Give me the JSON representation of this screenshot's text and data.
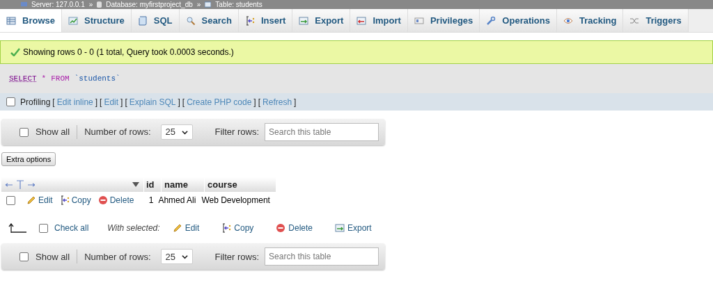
{
  "breadcrumb": {
    "separator": "»",
    "items": [
      {
        "kind": "server",
        "label": "Server: 127.0.0.1"
      },
      {
        "kind": "database",
        "label": "Database: myfirstproject_db"
      },
      {
        "kind": "table",
        "label": "Table: students"
      }
    ]
  },
  "tabs": [
    {
      "kind": "browse",
      "label": "Browse",
      "selected": true
    },
    {
      "kind": "structure",
      "label": "Structure",
      "selected": false
    },
    {
      "kind": "sql",
      "label": "SQL",
      "selected": false
    },
    {
      "kind": "search",
      "label": "Search",
      "selected": false
    },
    {
      "kind": "insert",
      "label": "Insert",
      "selected": false
    },
    {
      "kind": "export",
      "label": "Export",
      "selected": false
    },
    {
      "kind": "import",
      "label": "Import",
      "selected": false
    },
    {
      "kind": "privileges",
      "label": "Privileges",
      "selected": false
    },
    {
      "kind": "operations",
      "label": "Operations",
      "selected": false
    },
    {
      "kind": "tracking",
      "label": "Tracking",
      "selected": false
    },
    {
      "kind": "triggers",
      "label": "Triggers",
      "selected": false
    }
  ],
  "message": "Showing rows 0 - 0 (1 total, Query took 0.0003 seconds.)",
  "sql": [
    {
      "kind": "keyword",
      "text": "SELECT"
    },
    {
      "kind": "operator",
      "text": "*"
    },
    {
      "kind": "operator",
      "text": "FROM"
    },
    {
      "kind": "identifier",
      "text": "`students`"
    }
  ],
  "profiling": {
    "label": "Profiling",
    "checked": false,
    "open": "[",
    "close": "]",
    "links": [
      "Edit inline",
      "Edit",
      "Explain SQL",
      "Create PHP code",
      "Refresh"
    ]
  },
  "nav_top": {
    "show_all": "Show all",
    "show_all_checked": false,
    "rows_label": "Number of rows:",
    "rows_value": "25",
    "filter_label": "Filter rows:",
    "filter_placeholder": "Search this table"
  },
  "extra_options": "Extra options",
  "table": {
    "columns": [
      "id",
      "name",
      "course"
    ],
    "rows": [
      {
        "checked": false,
        "actions": [
          {
            "kind": "edit",
            "label": "Edit"
          },
          {
            "kind": "copy",
            "label": "Copy"
          },
          {
            "kind": "delete",
            "label": "Delete"
          }
        ],
        "cells": [
          "1",
          "Ahmed Ali",
          "Web Development"
        ]
      }
    ]
  },
  "bulk": {
    "check_all": "Check all",
    "checked": false,
    "with_selected": "With selected:",
    "actions": [
      {
        "kind": "edit",
        "label": "Edit"
      },
      {
        "kind": "copy",
        "label": "Copy"
      },
      {
        "kind": "delete",
        "label": "Delete"
      },
      {
        "kind": "export",
        "label": "Export"
      }
    ]
  },
  "nav_bottom": {
    "show_all": "Show all",
    "show_all_checked": false,
    "rows_label": "Number of rows:",
    "rows_value": "25",
    "filter_label": "Filter rows:",
    "filter_placeholder": "Search this table"
  }
}
